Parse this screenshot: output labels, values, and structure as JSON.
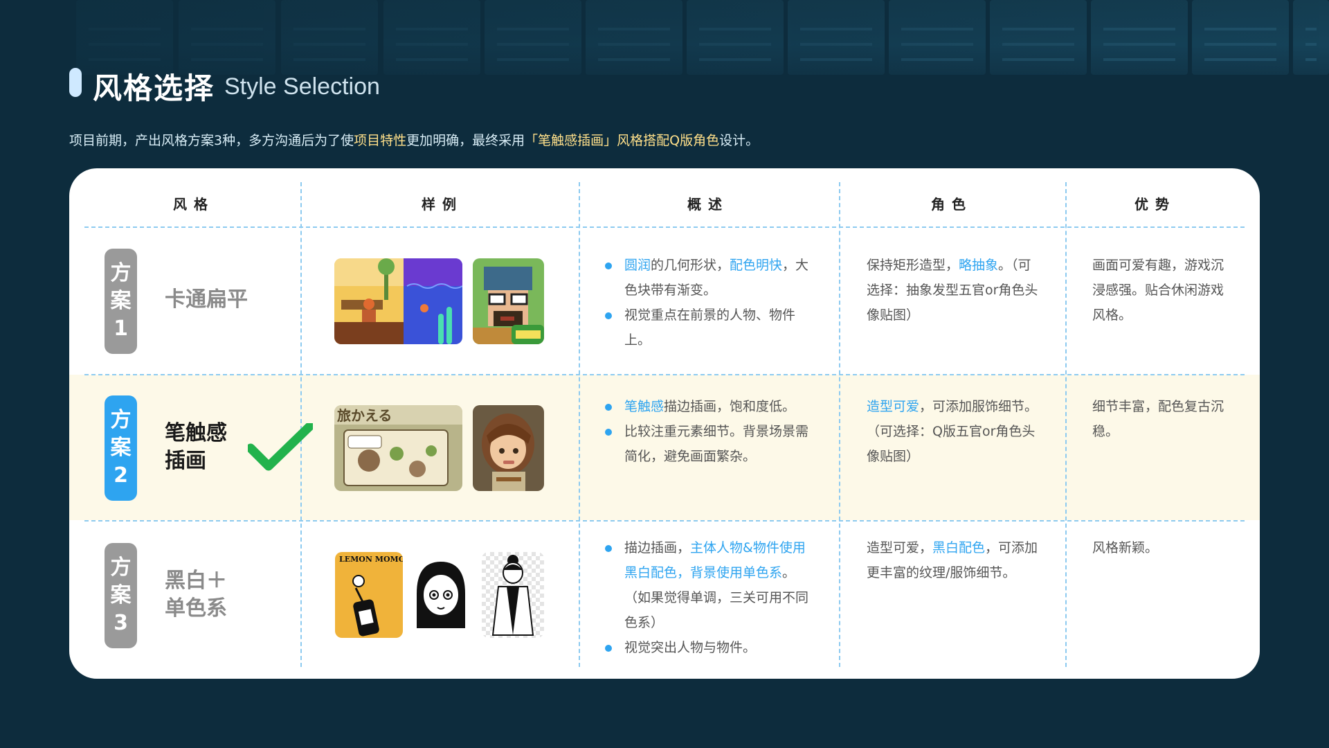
{
  "header": {
    "title_cn": "风格选择",
    "title_en": "Style Selection"
  },
  "intro": {
    "part1": "项目前期，产出风格方案3种，多方沟通后为了使",
    "hl1": "项目特性",
    "part2": "更加明确，最终采用",
    "hl2": "「笔触感插画」风格搭配Q版角色",
    "part3": "设计。"
  },
  "table": {
    "headers": [
      "风格",
      "样例",
      "概述",
      "角色",
      "优势"
    ],
    "rows": [
      {
        "tag": [
          "方",
          "案",
          "1"
        ],
        "style": [
          "卡通扁平"
        ],
        "selected": false,
        "summary": [
          {
            "b1": "圆润",
            "t1": "的几何形状，",
            "b2": "配色明快",
            "t2": "，大色块带有渐变。"
          },
          {
            "t1": "视觉重点在前景的人物、物件上。"
          }
        ],
        "role": {
          "t1": "保持矩形造型，",
          "b1": "略抽象",
          "t2": "。（可选择：抽象发型五官or角色头像贴图）"
        },
        "advantage": "画面可爱有趣，游戏沉浸感强。贴合休闲游戏风格。"
      },
      {
        "tag": [
          "方",
          "案",
          "2"
        ],
        "style": [
          "笔触感",
          "插画"
        ],
        "selected": true,
        "summary": [
          {
            "b1": "笔触感",
            "t1": "描边插画，饱和度低。"
          },
          {
            "t1": "比较注重元素细节。背景场景需简化，避免画面繁杂。"
          }
        ],
        "role": {
          "b1": "造型可爱",
          "t1": "，可添加服饰细节。（可选择：Q版五官or角色头像贴图）"
        },
        "advantage": "细节丰富，配色复古沉稳。"
      },
      {
        "tag": [
          "方",
          "案",
          "3"
        ],
        "style": [
          "黑白＋",
          "单色系"
        ],
        "selected": false,
        "summary": [
          {
            "t1": "描边插画，",
            "b1": "主体人物&物件使用黑白配色，背景使用单色系",
            "t2": "。（如果觉得单调，三关可用不同色系）"
          },
          {
            "t1": "视觉突出人物与物件。"
          }
        ],
        "role": {
          "t1": "造型可爱，",
          "b1": "黑白配色",
          "t2": "，可添加更丰富的纹理/服饰细节。"
        },
        "advantage": "风格新颖。"
      }
    ]
  },
  "sample_text": {
    "lemon": "LEMON MOMO",
    "game_logo": "旅かえる"
  },
  "colors": {
    "background": "#0d2c3d",
    "accent_blue": "#2ea4f0",
    "highlight_yellow": "#ffe08a",
    "check_green": "#22b24c",
    "selected_row_bg": "#fdf9e8"
  }
}
